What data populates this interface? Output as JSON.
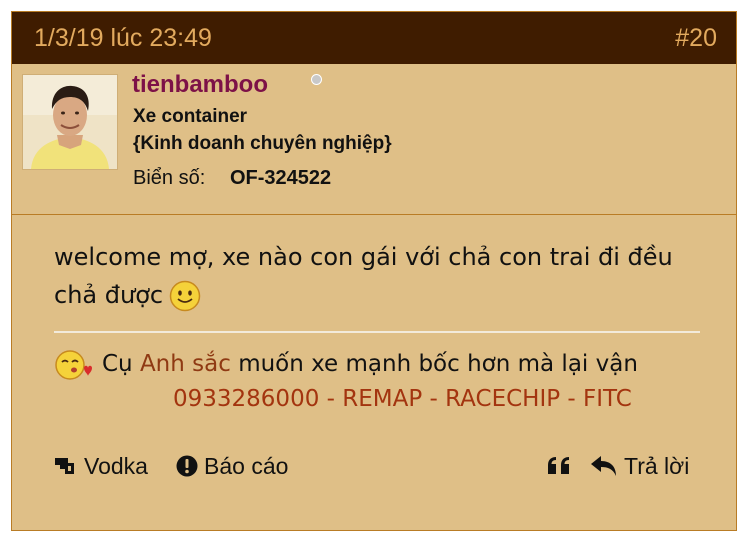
{
  "post": {
    "date": "1/3/19 lúc 23:49",
    "number": "#20",
    "user": {
      "username": "tienbamboo",
      "title": "Xe container",
      "subtitle": "{Kinh doanh chuyên nghiệp}",
      "plate_label": "Biển số:",
      "plate_value": "OF-324522"
    },
    "body": "welcome mợ, xe nào con gái với chả con trai đi đều chả được",
    "signature": {
      "prefix": "Cụ",
      "name": "Anh sắc",
      "rest": "muốn xe mạnh bốc hơn mà lại vận",
      "line2": "0933286000 - REMAP - RACECHIP - FITC"
    },
    "actions": {
      "vodka": "Vodka",
      "report": "Báo cáo",
      "reply": "Trả lời"
    }
  },
  "colors": {
    "header_bg": "#3f1c00",
    "header_text": "#e2aa5e",
    "post_bg": "#dfbf87",
    "username": "#7d1147",
    "signature_link": "#a3340f"
  }
}
